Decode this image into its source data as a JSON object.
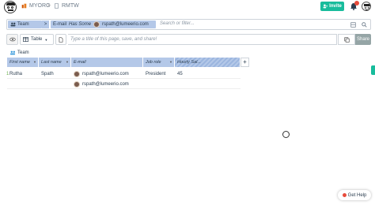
{
  "breadcrumb": {
    "org": "MYORG",
    "project": "RMTW"
  },
  "header": {
    "invite_label": "Invite"
  },
  "query": {
    "collection_chip": "Team",
    "filter_attribute": "E-mail",
    "filter_condition": "Has Some",
    "filter_value": "rspath@lumeerio.com",
    "search_placeholder": "Search or filter..."
  },
  "toolbar": {
    "view_type": "Table",
    "title_placeholder": "Type a title of this page, save, and share!",
    "share_label": "Share"
  },
  "table": {
    "collection": "Team",
    "columns": [
      "First name",
      "Last name",
      "E-mail",
      "Job role",
      "Hourly Sal..."
    ],
    "rows": [
      {
        "num": "1",
        "first": "Rutha",
        "last": "Spath",
        "email": "rspath@lumeerio.com",
        "role": "President",
        "salary": "45"
      },
      {
        "num": "",
        "first": "",
        "last": "",
        "email": "rspath@lumeerio.com",
        "role": "",
        "salary": ""
      }
    ]
  },
  "help": {
    "label": "Get Help"
  },
  "icons": [
    "logo-icon",
    "organization-icon",
    "project-icon",
    "invite-user-icon",
    "bell-icon",
    "avatar-icon",
    "team-icon",
    "eye-icon",
    "table-icon",
    "document-icon",
    "copy-icon",
    "plus-icon"
  ]
}
